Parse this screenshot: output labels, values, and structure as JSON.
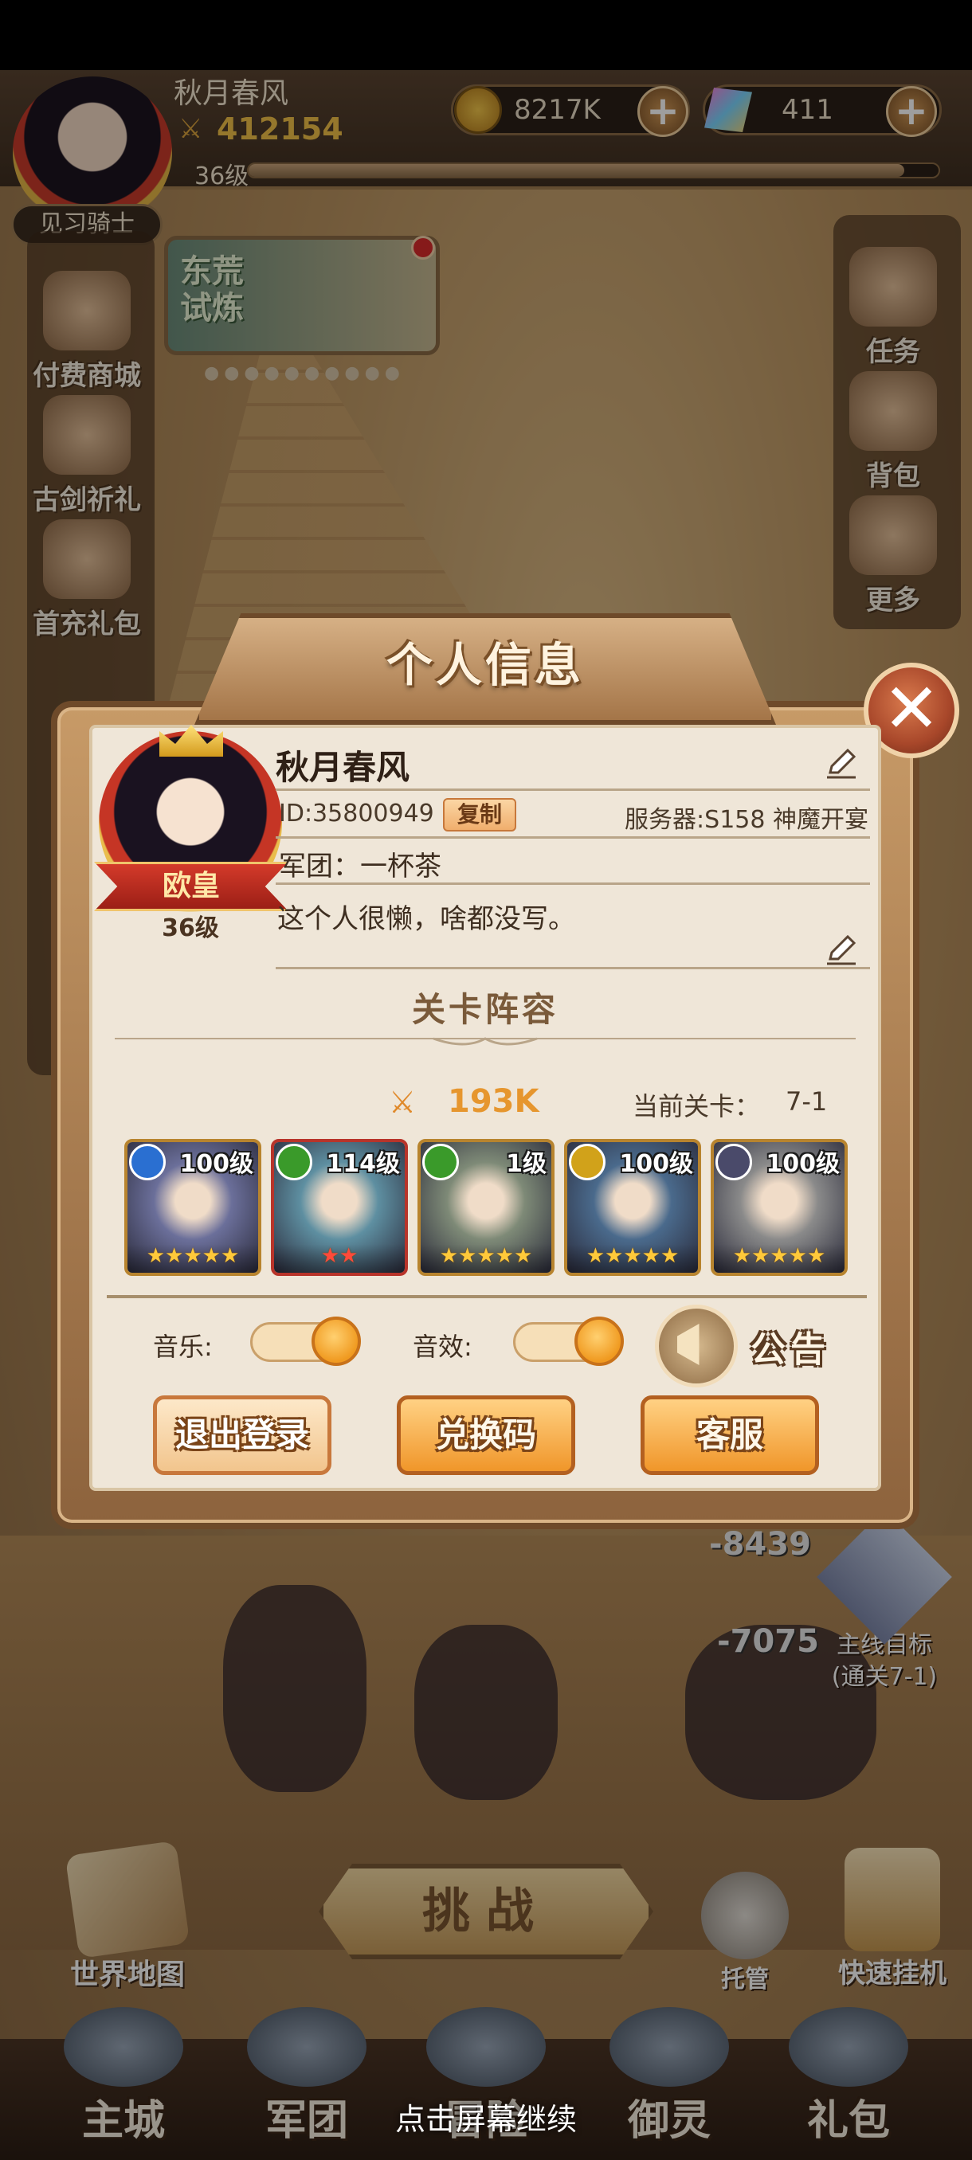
{
  "hud": {
    "player_name": "秋月春风",
    "power": "412154",
    "level": "36级",
    "rank": "见习骑士",
    "gold": "8217K",
    "gems": "411",
    "exp_fraction": 0.95
  },
  "event_banner": {
    "label": "东荒\n试炼"
  },
  "side_left": [
    "付费商城",
    "古剑祈礼",
    "首充礼包"
  ],
  "side_right": [
    "任务",
    "背包",
    "更多"
  ],
  "battle": {
    "damage_1": "-8439",
    "damage_2": "-7075",
    "goal_title": "主线目标",
    "goal_sub": "(通关7-1)",
    "challenge": "挑战",
    "world_map": "世界地图",
    "auto": "托管",
    "quick_idle": "快速挂机"
  },
  "bottom_nav": [
    "主城",
    "军团",
    "冒险",
    "御灵",
    "礼包"
  ],
  "continue_hint": "点击屏幕继续",
  "modal": {
    "title": "个人信息",
    "name": "秋月春风",
    "vip_title": "欧皇",
    "avatar_level": "36级",
    "id": "ID:35800949",
    "copy": "复制",
    "server": "服务器:S158 神魔开宴",
    "guild": "军团：一杯茶",
    "signature": "这个人很懒，啥都没写。",
    "section_title": "关卡阵容",
    "power": "193K",
    "stage_label": "当前关卡：",
    "stage_value": "7-1",
    "heroes": [
      {
        "level": "100级",
        "badge_color": "#2a6fd1",
        "stars": "★★★★★",
        "star_color": "#ffc93a",
        "bg": "#6b6f9a",
        "frame": "#b8842e"
      },
      {
        "level": "114级",
        "badge_color": "#3a9a2a",
        "stars": "★★",
        "star_color": "#ff4a3a",
        "bg": "#5e8fa1",
        "frame": "#b8342a"
      },
      {
        "level": "1级",
        "badge_color": "#3a9a2a",
        "stars": "★★★★★",
        "star_color": "#ffc93a",
        "bg": "#7e8a77",
        "frame": "#b8842e"
      },
      {
        "level": "100级",
        "badge_color": "#d1a21a",
        "stars": "★★★★★",
        "star_color": "#ffc93a",
        "bg": "#4a6a8c",
        "frame": "#b8842e"
      },
      {
        "level": "100级",
        "badge_color": "#4a4a6a",
        "stars": "★★★★★",
        "star_color": "#ffc93a",
        "bg": "#8a8a8a",
        "frame": "#b8842e"
      }
    ],
    "music_label": "音乐:",
    "sfx_label": "音效:",
    "notice_label": "公告",
    "logout": "退出登录",
    "redeem": "兑换码",
    "support": "客服"
  }
}
